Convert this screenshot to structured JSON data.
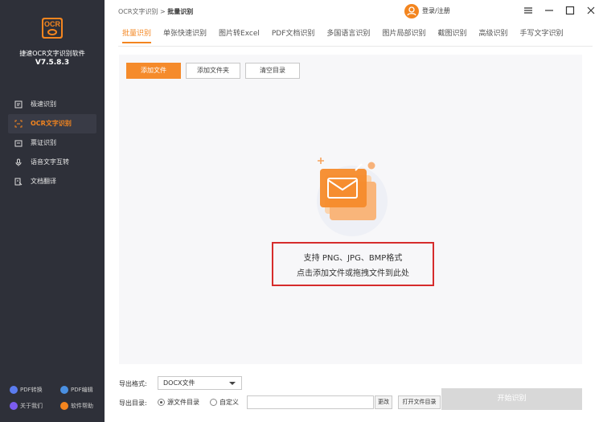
{
  "app": {
    "logo_text": "OCR",
    "name": "捷速OCR文字识别软件",
    "version": "V7.5.8.3"
  },
  "sidebar": {
    "items": [
      {
        "label": "极速识别",
        "icon": "scan-icon",
        "active": false
      },
      {
        "label": "OCR文字识别",
        "icon": "ocr-frame-icon",
        "active": true
      },
      {
        "label": "票证识别",
        "icon": "ticket-icon",
        "active": false
      },
      {
        "label": "语音文字互转",
        "icon": "microphone-icon",
        "active": false
      },
      {
        "label": "文档翻译",
        "icon": "translate-icon",
        "active": false
      }
    ],
    "bottom_links": [
      {
        "label": "PDF转换",
        "icon": "pdf-convert-icon",
        "color": "#5b7cf0"
      },
      {
        "label": "PDF编辑",
        "icon": "pdf-edit-icon",
        "color": "#4a90e2"
      },
      {
        "label": "关于我们",
        "icon": "info-icon",
        "color": "#7b5cf0"
      },
      {
        "label": "软件帮助",
        "icon": "help-icon",
        "color": "#f3851f"
      }
    ]
  },
  "header": {
    "breadcrumb_root": "OCR文字识别",
    "breadcrumb_sep": ">",
    "breadcrumb_current": "批量识别",
    "login_label": "登录/注册"
  },
  "tabs": [
    {
      "label": "批量识别",
      "active": true
    },
    {
      "label": "单张快速识别",
      "active": false
    },
    {
      "label": "图片转Excel",
      "active": false
    },
    {
      "label": "PDF文档识别",
      "active": false
    },
    {
      "label": "多国语言识别",
      "active": false
    },
    {
      "label": "图片局部识别",
      "active": false
    },
    {
      "label": "截图识别",
      "active": false
    },
    {
      "label": "高级识别",
      "active": false
    },
    {
      "label": "手写文字识别",
      "active": false
    }
  ],
  "toolbar": {
    "add_file": "添加文件",
    "add_folder": "添加文件夹",
    "clear_list": "清空目录"
  },
  "dropzone": {
    "line1": "支持 PNG、JPG、BMP格式",
    "line2": "点击添加文件或拖拽文件到此处"
  },
  "footer": {
    "format_label": "导出格式:",
    "format_value": "DOCX文件",
    "dir_label": "导出目录:",
    "radio_source": "源文件目录",
    "radio_custom": "自定义",
    "path_value": "",
    "change_button": "更改",
    "open_dir_button": "打开文件目录",
    "start_button": "开始识别"
  },
  "colors": {
    "accent": "#f3851f",
    "sidebar_bg": "#2e3039",
    "highlight_border": "#d62c2c",
    "disabled_button": "#d8d8d8"
  }
}
